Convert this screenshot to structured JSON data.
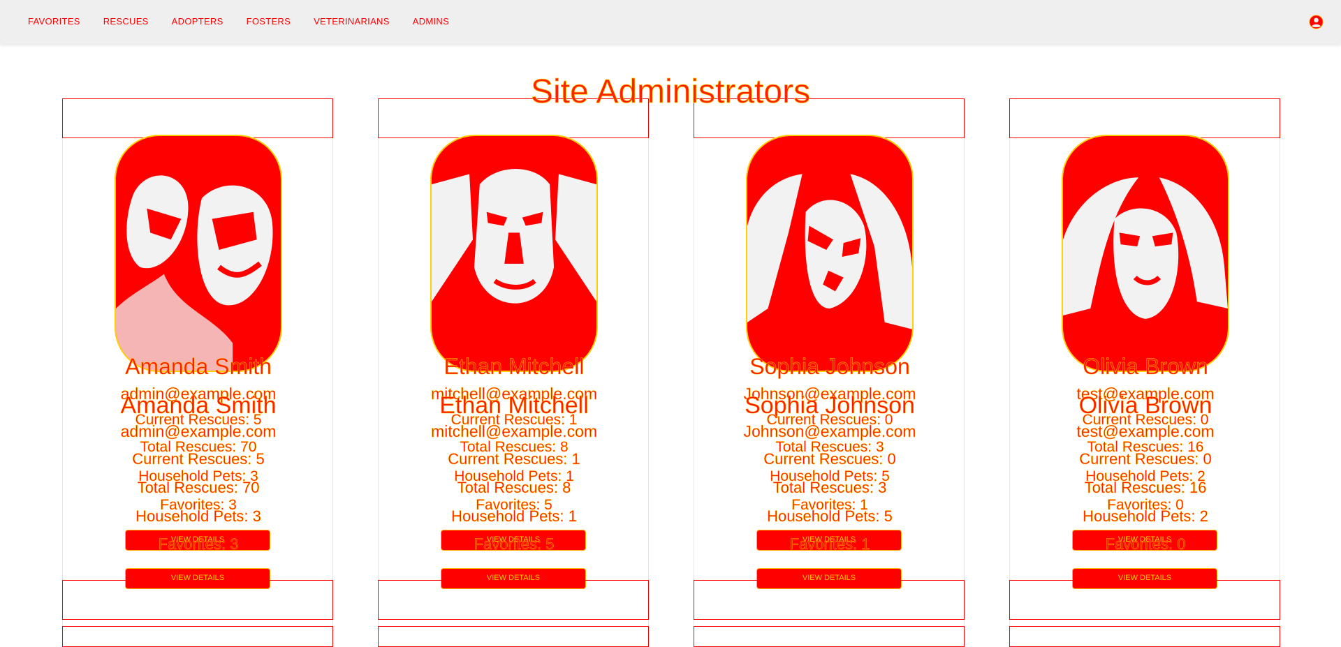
{
  "nav": {
    "links": [
      "FAVORITES",
      "RESCUES",
      "ADOPTERS",
      "FOSTERS",
      "VETERINARIANS",
      "ADMINS"
    ],
    "account_icon": "account-circle-icon"
  },
  "page": {
    "title": "Site Administrators"
  },
  "colors": {
    "accent": "#ff0000",
    "text_outline": "#ffc800",
    "nav_background": "#efefef"
  },
  "admins": [
    {
      "name": "Amanda Smith",
      "email": "admin@example.com",
      "current_rescues": "Current Rescues: 5",
      "total_rescues": "Total Rescues: 70",
      "household_pets": "Household Pets: 3",
      "favorites": "Favorites: 3",
      "button_label": "VIEW DETAILS"
    },
    {
      "name": "Ethan Mitchell",
      "email": "mitchell@example.com",
      "current_rescues": "Current Rescues: 1",
      "total_rescues": "Total Rescues: 8",
      "household_pets": "Household Pets: 1",
      "favorites": "Favorites: 5",
      "button_label": "VIEW DETAILS"
    },
    {
      "name": "Sophia Johnson",
      "email": "Johnson@example.com",
      "current_rescues": "Current Rescues: 0",
      "total_rescues": "Total Rescues: 3",
      "household_pets": "Household Pets: 5",
      "favorites": "Favorites: 1",
      "button_label": "VIEW DETAILS"
    },
    {
      "name": "Olivia Brown",
      "email": "test@example.com",
      "current_rescues": "Current Rescues: 0",
      "total_rescues": "Total Rescues: 16",
      "household_pets": "Household Pets: 2",
      "favorites": "Favorites: 0",
      "button_label": "VIEW DETAILS"
    }
  ]
}
